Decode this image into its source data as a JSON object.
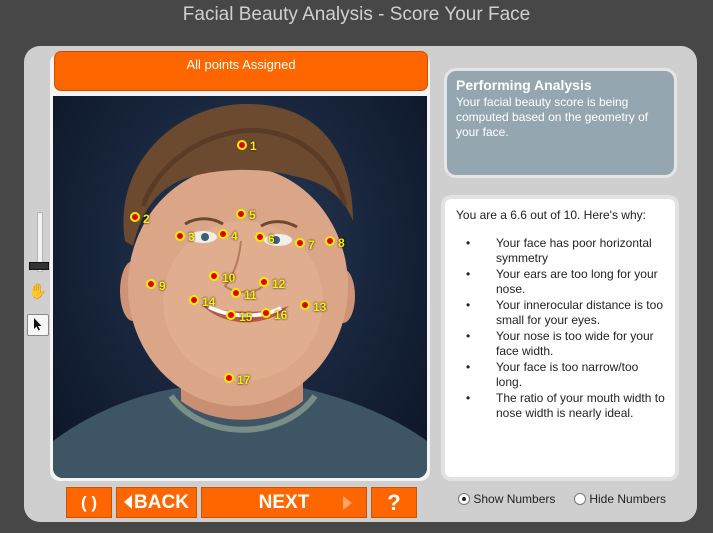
{
  "window": {
    "title": "Facial Beauty Analysis - Score Your Face"
  },
  "image_panel": {
    "header": "All points Assigned"
  },
  "landmarks": [
    "1",
    "2",
    "3",
    "4",
    "5",
    "6",
    "7",
    "8",
    "9",
    "10",
    "11",
    "12",
    "13",
    "14",
    "15",
    "16",
    "17"
  ],
  "status": {
    "title": "Performing Analysis",
    "body": "Your facial beauty score is being computed based on the geometry of your face."
  },
  "results": {
    "summary": "You are a 6.6 out of 10.  Here's why:",
    "reasons": [
      "Your face has poor horizontal symmetry",
      "Your ears are too long for your nose.",
      "Your innerocular distance is too small for your eyes.",
      "Your nose is too wide for your face width.",
      "Your face is too narrow/too long.",
      "The ratio of your mouth width to nose width is nearly ideal."
    ]
  },
  "controls": {
    "refresh_label": "( )",
    "back_label": "BACK",
    "next_label": "NEXT",
    "help_label": "?",
    "show_numbers_label": "Show Numbers",
    "hide_numbers_label": "Hide Numbers",
    "show_numbers_selected": true
  },
  "colors": {
    "accent": "#ff6600",
    "landmark_fill": "#e30000",
    "landmark_ring": "#ffee00",
    "status_panel": "#94a7b0"
  },
  "icons": {
    "zoom": "zoom-slider",
    "hand": "hand-pan-icon",
    "pointer": "arrow-pointer-icon",
    "refresh": "refresh-icon"
  }
}
